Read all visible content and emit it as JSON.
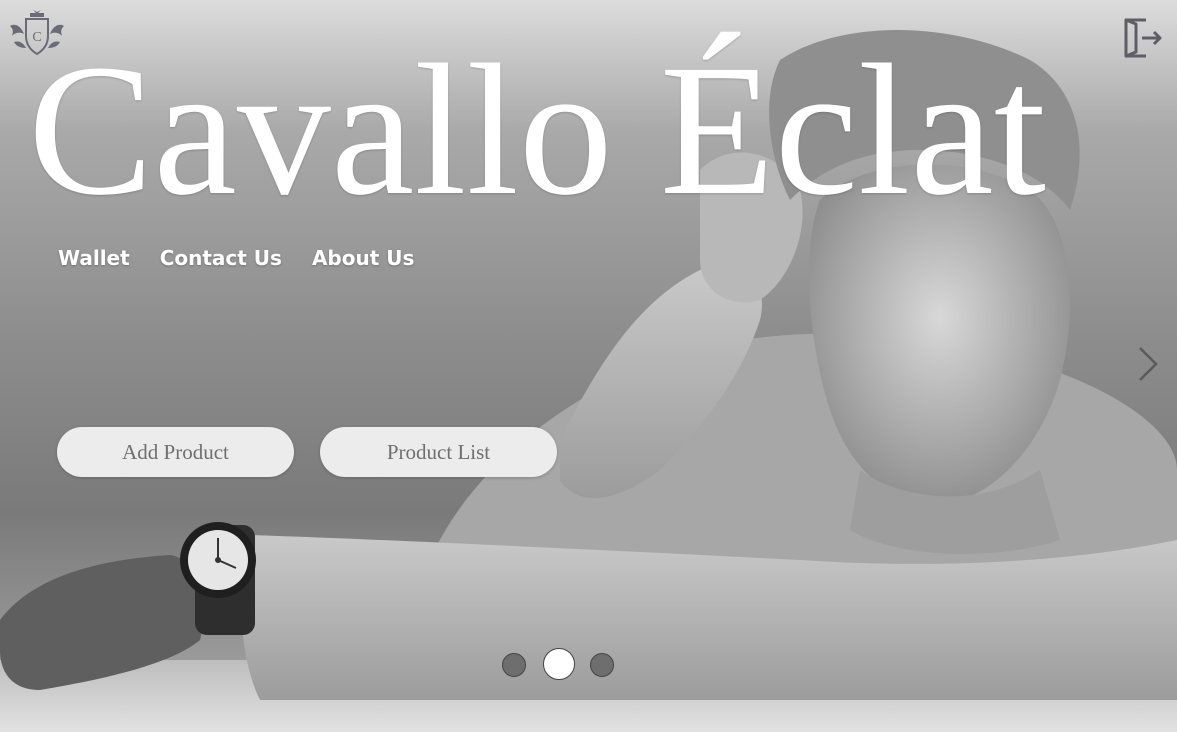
{
  "brand": {
    "title": "Cavallo Éclat",
    "logo_icon": "crest-logo-icon",
    "logo_letter": "C"
  },
  "header": {
    "logout_icon": "logout-icon"
  },
  "nav": {
    "items": [
      {
        "label": "Wallet"
      },
      {
        "label": "Contact Us"
      },
      {
        "label": "About Us"
      }
    ]
  },
  "actions": {
    "add_product_label": "Add Product",
    "product_list_label": "Product List"
  },
  "carousel": {
    "next_icon": "chevron-right-icon",
    "slide_count": 3,
    "active_index": 2
  },
  "colors": {
    "title": "#ffffff",
    "button_bg": "#ececec",
    "button_text": "#6f6f6f",
    "dot_inactive": "#6e6e6e",
    "dot_active": "#ffffff"
  }
}
